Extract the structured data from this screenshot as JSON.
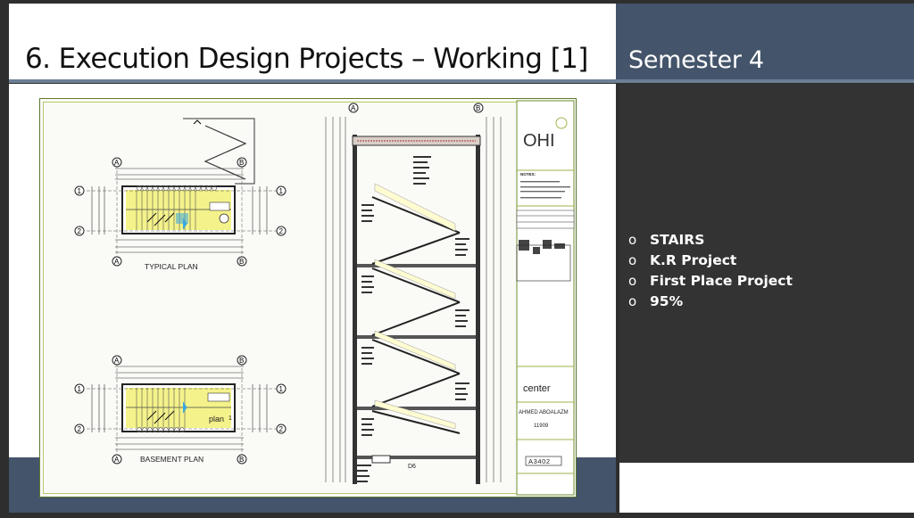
{
  "slide": {
    "title": "6.   Execution Design Projects – Working [1]",
    "semester": "Semester 4",
    "bullets": [
      "STAIRS",
      "K.R Project",
      "First Place Project",
      "95%"
    ]
  },
  "drawing": {
    "typical_plan_label": "TYPICAL PLAN",
    "basement_plan_label": "BASEMENT PLAN",
    "plan_tag": "plan",
    "plan_tag_num": "1",
    "grid_a": "A",
    "grid_b": "B",
    "grid_1": "1",
    "grid_2": "2",
    "section_note": "D6",
    "title_block": {
      "logo": "OHI",
      "notes_heading": "NOTES:",
      "client": "center",
      "student": "AHMED ABOALAZM",
      "student_id": "11909",
      "sheet": "A3402"
    }
  },
  "colors": {
    "slide_bg": "#2e2e2e",
    "accent_blue": "#44546a",
    "title_text": "#111111",
    "frame_green": "#5d7a2f",
    "highlight_cyan": "#3aa7e0",
    "highlight_yellow": "#f4f28a"
  },
  "icons": {
    "bullet": "hollow-circle-bullet",
    "north_arrow": "north-arrow-icon"
  }
}
